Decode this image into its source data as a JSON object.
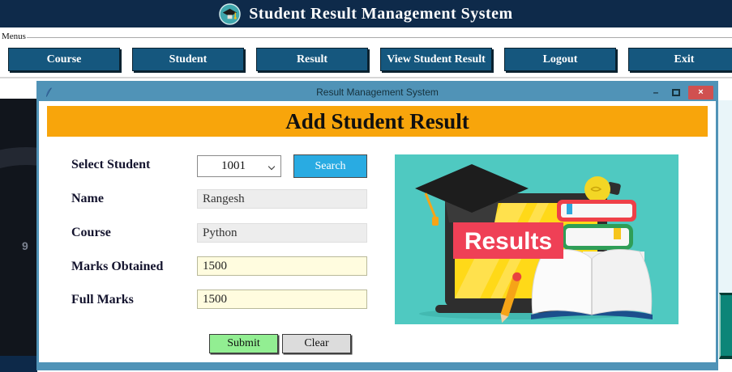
{
  "app": {
    "title": "Student Result Management System"
  },
  "menus": {
    "label": "Menus",
    "items": [
      "Course",
      "Student",
      "Result",
      "View Student Result",
      "Logout",
      "Exit"
    ]
  },
  "window": {
    "title": "Result Management System",
    "minimize_glyph": "–",
    "close_glyph": "×"
  },
  "form": {
    "heading": "Add Student Result",
    "select_student_label": "Select Student",
    "student_id": "1001",
    "search_label": "Search",
    "name_label": "Name",
    "name_value": "Rangesh",
    "course_label": "Course",
    "course_value": "Python",
    "marks_label": "Marks Obtained",
    "marks_value": "1500",
    "full_marks_label": "Full Marks",
    "full_marks_value": "1500",
    "submit_label": "Submit",
    "clear_label": "Clear"
  },
  "illustration": {
    "caption": "Results"
  },
  "background": {
    "clock_digit": "9"
  },
  "colors": {
    "header_navy": "#0e2a4a",
    "menu_button": "#15577e",
    "titlebar_blue": "#5093b7",
    "close_red": "#d05050",
    "banner_orange": "#f8a50b",
    "search_blue": "#29abe2",
    "submit_green": "#92ee92",
    "clear_gray": "#dcdcdc",
    "field_yellow": "#fffcdf",
    "field_gray": "#ededed",
    "illustration_teal": "#4fc9c1",
    "results_red": "#ef4056"
  }
}
